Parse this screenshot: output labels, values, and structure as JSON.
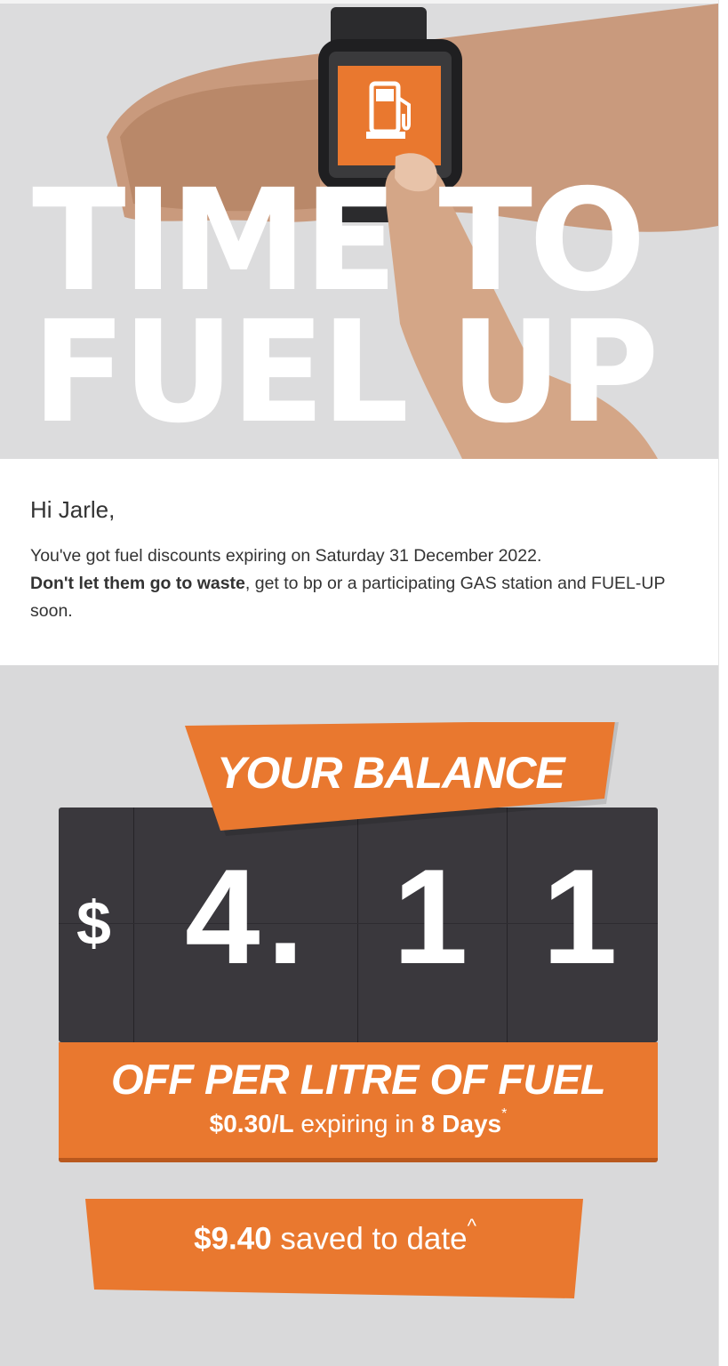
{
  "hero": {
    "line1": "TIME TO",
    "line2": "FUEL UP",
    "watch_icon": "fuel-pump-icon"
  },
  "greeting": {
    "title": "Hi Jarle,",
    "body_line1": "You've got fuel discounts expiring on Saturday 31 December 2022.",
    "body_bold": "Don't let them go to waste",
    "body_rest": ", get to bp or a participating GAS station and FUEL-UP soon."
  },
  "balance": {
    "banner": "YOUR BALANCE",
    "currency": "$",
    "digit1": "4",
    "dot": ".",
    "digit2": "1",
    "digit3": "1",
    "off_title": "OFF PER LITRE OF FUEL",
    "rate": "$0.30/L",
    "expiring_text": " expiring in ",
    "days": "8 Days",
    "asterisk": "*"
  },
  "saved": {
    "amount": "$9.40",
    "text": " saved to date",
    "caret": "^"
  },
  "colors": {
    "accent_orange": "#e9782f",
    "board_dark": "#3a383d",
    "hero_grey": "#dcdcdd"
  }
}
